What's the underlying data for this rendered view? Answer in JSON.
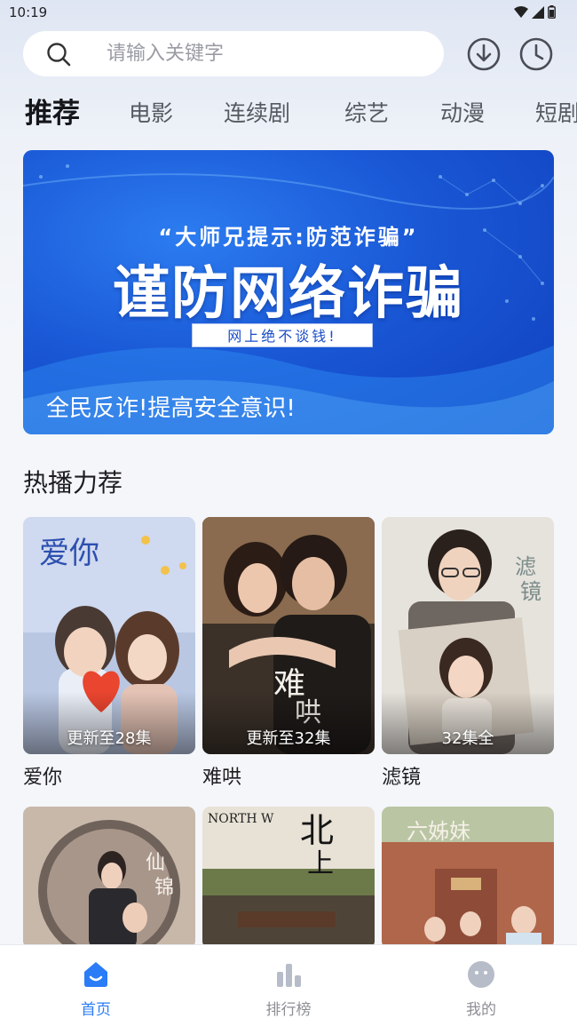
{
  "status_bar": {
    "time": "10:19",
    "icons": [
      "wifi-icon",
      "signal-icon",
      "battery-icon"
    ]
  },
  "search": {
    "placeholder": "请输入关键字"
  },
  "header": {
    "icons": [
      "download-icon",
      "history-icon"
    ]
  },
  "tabs": [
    {
      "label": "推荐",
      "active": true
    },
    {
      "label": "电影"
    },
    {
      "label": "连续剧"
    },
    {
      "label": "综艺"
    },
    {
      "label": "动漫"
    },
    {
      "label": "短剧"
    }
  ],
  "banner": {
    "quote": "“大师兄提示:防范诈骗”",
    "title": "谨防网络诈骗",
    "tag": "网上绝不谈钱!",
    "bottom": "全民反诈!提高安全意识!"
  },
  "section": {
    "title": "热播力荐"
  },
  "cards": [
    {
      "title": "爱你",
      "update": "更新至28集"
    },
    {
      "title": "难哄",
      "update": "更新至32集"
    },
    {
      "title": "滤镜",
      "update": "32集全"
    },
    {
      "title": "",
      "update": ""
    },
    {
      "title": "",
      "update": ""
    },
    {
      "title": "",
      "update": ""
    }
  ],
  "bottom_nav": [
    {
      "label": "首页",
      "icon": "home-icon",
      "active": true
    },
    {
      "label": "排行榜",
      "icon": "ranking-icon"
    },
    {
      "label": "我的",
      "icon": "profile-icon"
    }
  ],
  "colors": {
    "accent": "#2a7cf7",
    "banner_blue": "#1a58d6",
    "inactive": "#8d8f96"
  }
}
